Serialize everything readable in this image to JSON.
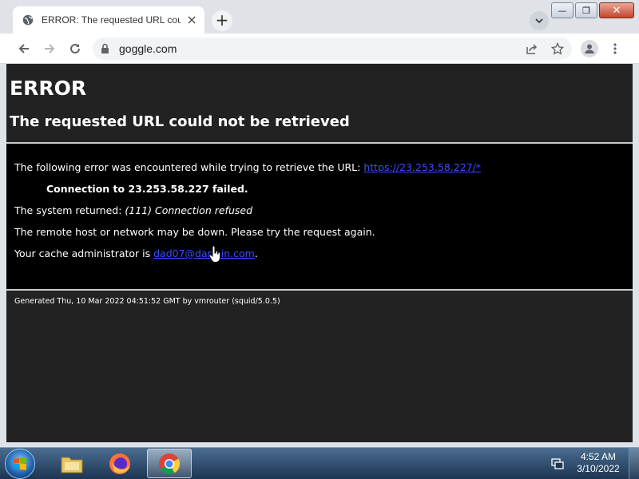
{
  "browser": {
    "tab": {
      "title": "ERROR: The requested URL could not be retrieved",
      "close": "×"
    },
    "new_tab": "+",
    "address": "goggle.com",
    "window_controls": {
      "minimize": "—",
      "maximize": "❐",
      "close": "✕"
    }
  },
  "page": {
    "h1": "ERROR",
    "h2": "The requested URL could not be retrieved",
    "line1_prefix": "The following error was encountered while trying to retrieve the URL: ",
    "line1_link": "https://23.253.58.227/*",
    "line2": "Connection to 23.253.58.227 failed.",
    "line3_prefix": "The system returned: ",
    "line3_italic": "(111) Connection refused",
    "line4": "The remote host or network may be down. Please try the request again.",
    "line5_prefix": "Your cache administrator is ",
    "line5_link": "dad07@darmin.com",
    "line5_suffix": ".",
    "footer": "Generated Thu, 10 Mar 2022 04:51:52 GMT by vmrouter (squid/5.0.5)",
    "colors": {
      "background": "#222222",
      "message_block": "#000000",
      "link": "#3b4bff"
    }
  },
  "taskbar": {
    "time": "4:52 AM",
    "date": "3/10/2022",
    "apps": [
      "file-explorer",
      "firefox",
      "chrome"
    ],
    "active_app": "chrome"
  }
}
